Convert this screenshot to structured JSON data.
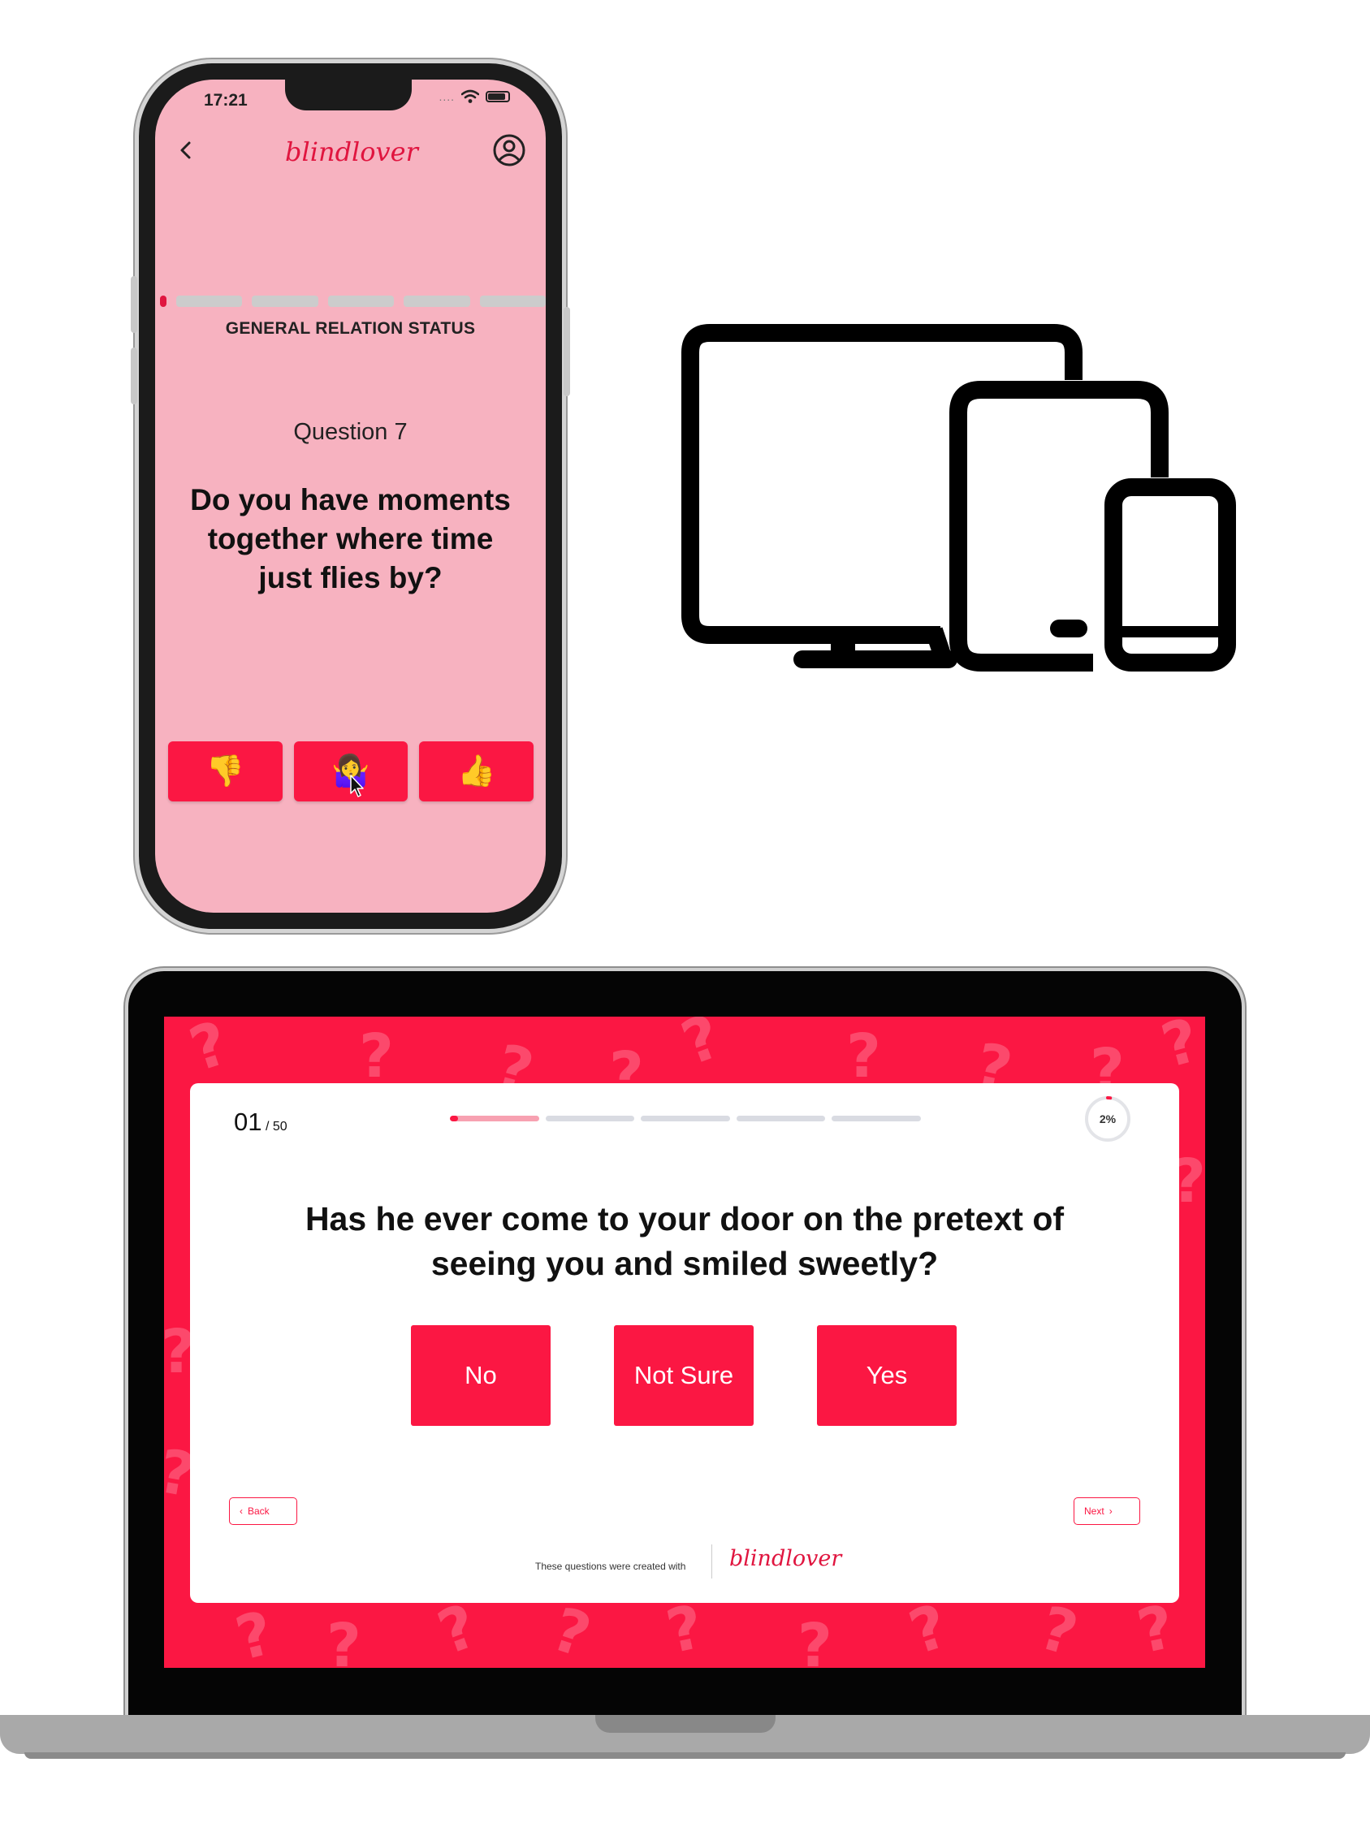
{
  "phone": {
    "status_time": "17:21",
    "status_dots": "....",
    "app_logo": "blindlover",
    "back_icon": "chevron-left-icon",
    "profile_icon": "user-circle-icon",
    "category": "GENERAL RELATION STATUS",
    "question_number": "Question 7",
    "question_text": "Do you have moments together where time just flies by?",
    "answers": [
      "👎",
      "🤷‍♀️",
      "👍"
    ],
    "accent_color": "#e0153f",
    "background_color": "#f7b2c0"
  },
  "devices_icon": "devices-icon",
  "web": {
    "counter_current": "01",
    "counter_total": "/ 50",
    "progress_percent": "2%",
    "progress_value": 0.02,
    "question_text": "Has he ever come to your door on the pretext of seeing you and smiled sweetly?",
    "answers": [
      "No",
      "Not Sure",
      "Yes"
    ],
    "back_label": "Back",
    "next_label": "Next",
    "footer_note": "These questions were created with",
    "footer_logo": "blindlover",
    "accent_color": "#fb1743"
  }
}
